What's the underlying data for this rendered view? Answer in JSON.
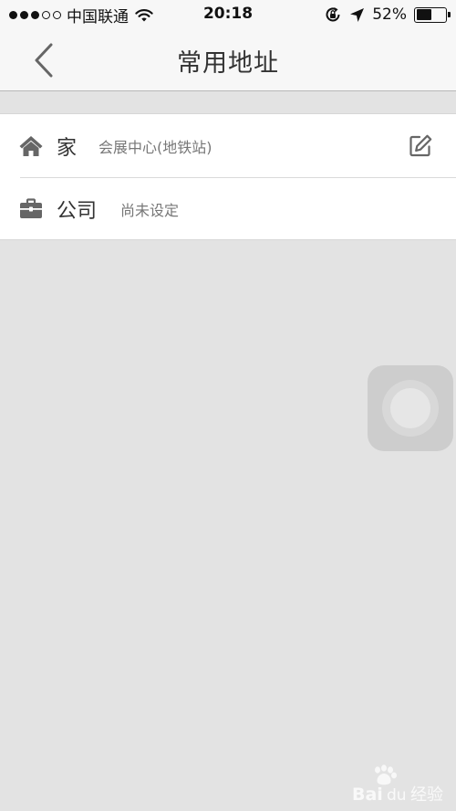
{
  "status_bar": {
    "carrier": "中国联通",
    "time": "20:18",
    "battery_percent_text": "52%",
    "battery_level": 0.52,
    "signal_bars_filled": 3,
    "signal_bars_total": 5
  },
  "nav": {
    "title": "常用地址",
    "back_icon": "chevron-left-icon"
  },
  "addresses": [
    {
      "label": "家",
      "value": "会展中心(地铁站)",
      "icon": "home-icon"
    },
    {
      "label": "公司",
      "value": "尚未设定",
      "icon": "briefcase-icon"
    }
  ],
  "watermark": {
    "text": "Bai du 经验"
  },
  "colors": {
    "background": "#e3e3e3",
    "bar": "#f7f7f7",
    "icon": "#666666"
  }
}
